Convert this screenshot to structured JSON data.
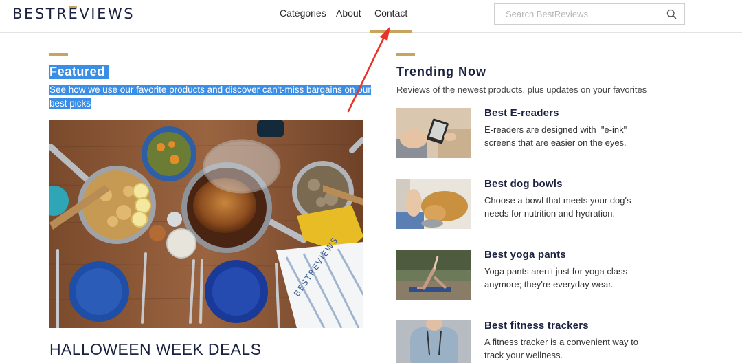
{
  "header": {
    "logo_text": "BESTREVIEWS",
    "nav": [
      {
        "label": "Categories"
      },
      {
        "label": "About"
      },
      {
        "label": "Contact"
      }
    ],
    "active_nav": "Contact",
    "search_placeholder": "Search BestReviews",
    "icons": {
      "search": "search-icon"
    }
  },
  "featured": {
    "title": "Featured",
    "description": "See how we use our favorite products and discover can't-miss bargains on our best picks",
    "image_alt": "Overhead view of a dinner table with roasted chicken, skillets, blue plates and a BestReviews towel",
    "image_label": "BESTREVIEWS",
    "headline": "HALLOWEEN WEEK DEALS"
  },
  "trending": {
    "title": "Trending Now",
    "subtitle": "Reviews of the newest products, plus updates on your favorites",
    "items": [
      {
        "title": "Best E-readers",
        "description": "E-readers are designed with  \"e-ink\" screens that are easier on the eyes."
      },
      {
        "title": "Best dog bowls",
        "description": "Choose a bowl that meets your dog's needs for nutrition and hydration."
      },
      {
        "title": "Best yoga pants",
        "description": "Yoga pants aren't just for yoga class anymore; they're everyday wear."
      },
      {
        "title": "Best fitness trackers",
        "description": "A fitness tracker is a convenient way to track your wellness."
      }
    ]
  },
  "colors": {
    "accent_gold": "#c8a45c",
    "navy": "#1b2140",
    "selection_blue": "#3a8ee6",
    "annotation_red": "#e8332a"
  }
}
